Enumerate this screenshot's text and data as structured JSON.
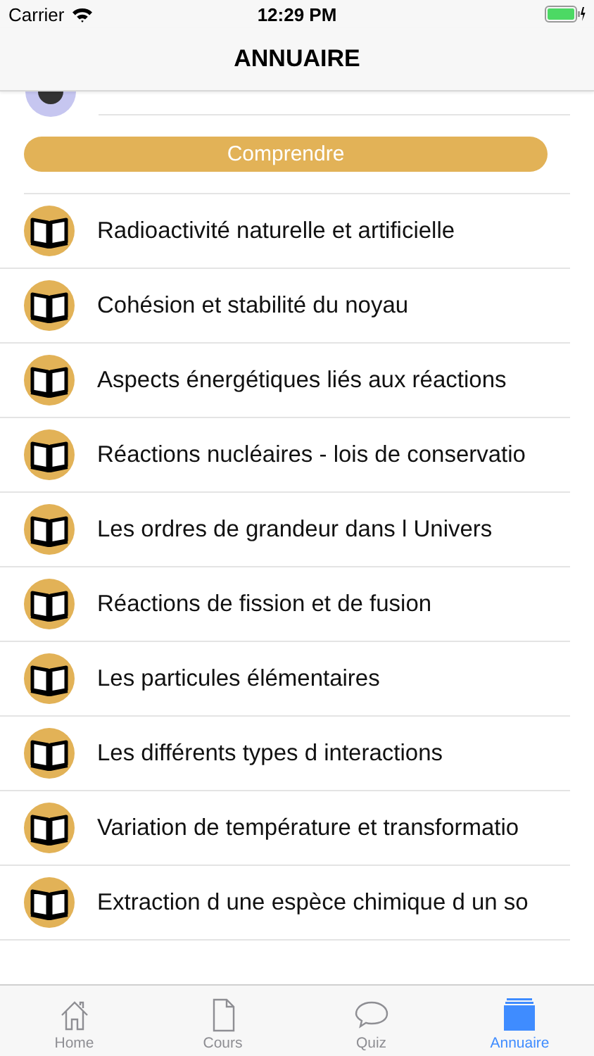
{
  "status_bar": {
    "carrier": "Carrier",
    "time": "12:29 PM"
  },
  "nav_bar": {
    "title": "ANNUAIRE"
  },
  "section_button": {
    "label": "Comprendre"
  },
  "items": [
    {
      "title": "Radioactivité naturelle et artificielle"
    },
    {
      "title": "Cohésion et stabilité du noyau"
    },
    {
      "title": "Aspects énergétiques liés aux réactions"
    },
    {
      "title": "Réactions nucléaires - lois de conservatio"
    },
    {
      "title": "Les ordres de grandeur dans l Univers"
    },
    {
      "title": "Réactions de fission et de fusion"
    },
    {
      "title": "Les particules élémentaires"
    },
    {
      "title": "Les différents types d interactions"
    },
    {
      "title": "Variation de température et transformatio"
    },
    {
      "title": "Extraction d une espèce chimique d un so"
    }
  ],
  "tab_bar": [
    {
      "label": "Home",
      "kind": "home",
      "selected": false
    },
    {
      "label": "Cours",
      "kind": "document",
      "selected": false
    },
    {
      "label": "Quiz",
      "kind": "chat",
      "selected": false
    },
    {
      "label": "Annuaire",
      "kind": "folder",
      "selected": true
    }
  ]
}
